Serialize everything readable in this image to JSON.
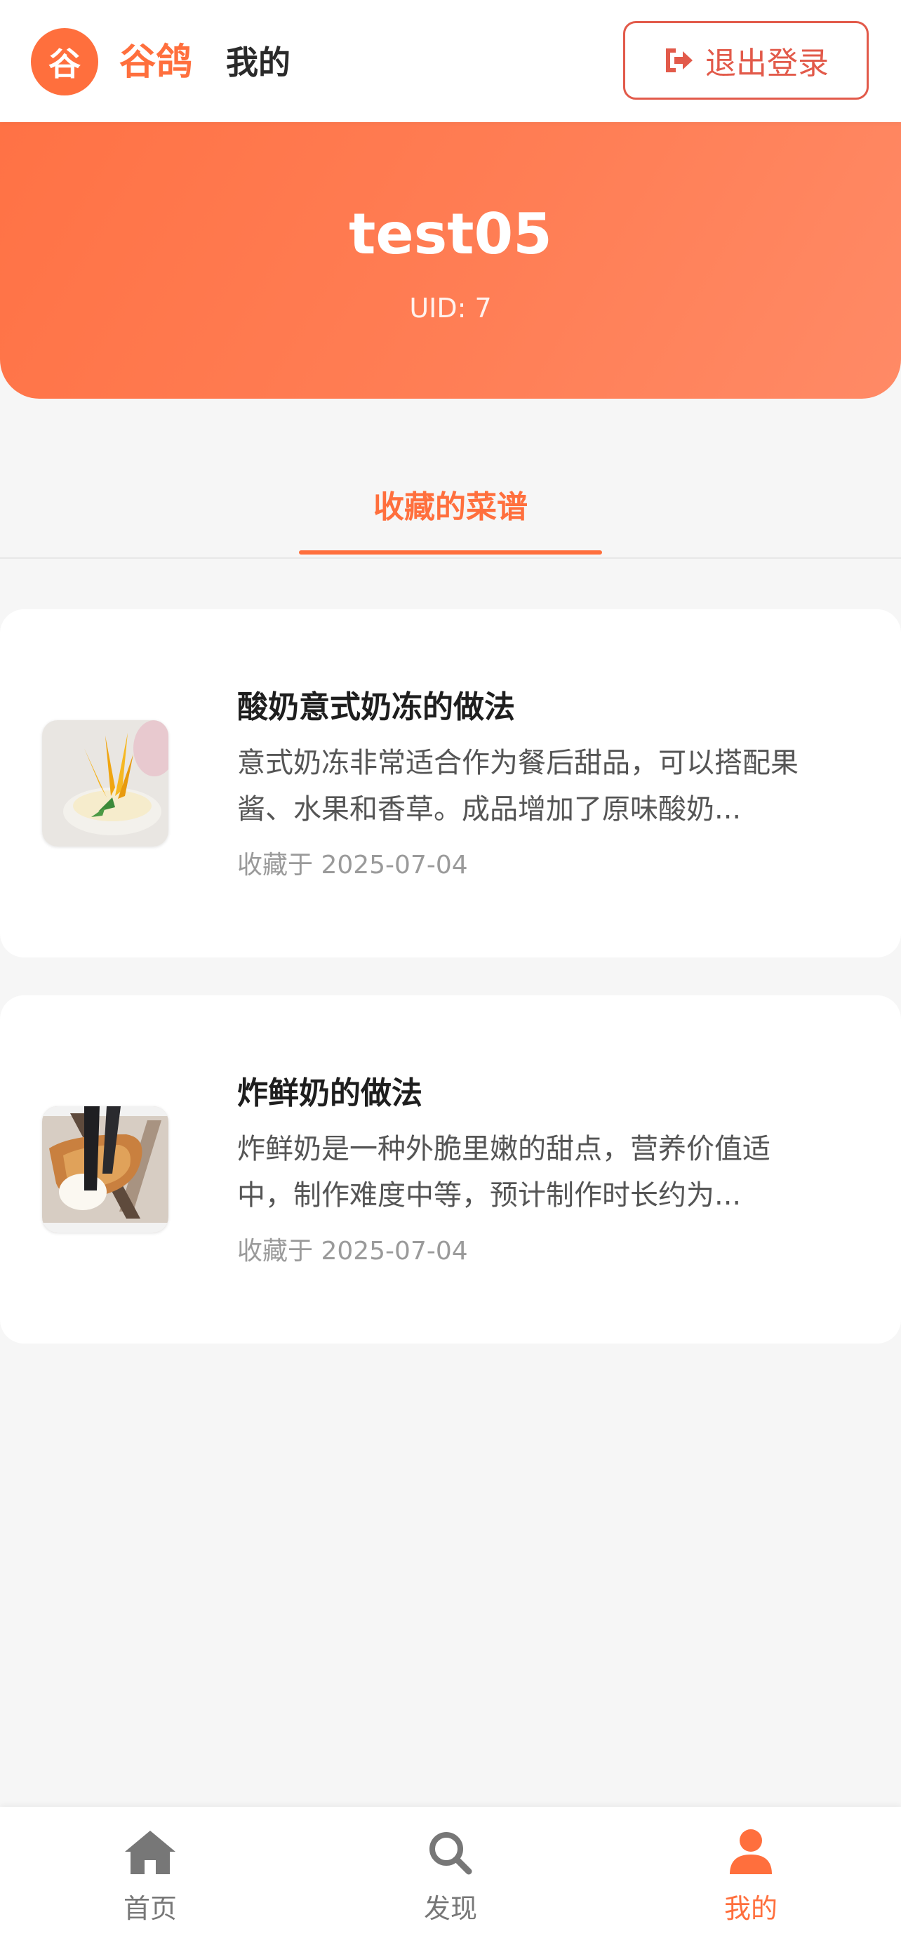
{
  "header": {
    "logo_char": "谷",
    "brand": "谷鸽",
    "page_title": "我的",
    "logout_label": "退出登录"
  },
  "profile": {
    "username": "test05",
    "uid": "UID: 7"
  },
  "tabs": [
    {
      "label": "收藏的菜谱",
      "active": true
    }
  ],
  "favorites": [
    {
      "title": "酸奶意式奶冻的做法",
      "desc_line1": "意式奶冻非常适合作为餐后甜品，可以搭配果",
      "desc_line2": "酱、水果和香草。成品增加了原味酸奶...",
      "date": "收藏于 2025-07-04"
    },
    {
      "title": "炸鲜奶的做法",
      "desc_line1": "炸鲜奶是一种外脆里嫩的甜点，营养价值适",
      "desc_line2": "中，制作难度中等，预计制作时长约为...",
      "date": "收藏于 2025-07-04"
    }
  ],
  "bottom_nav": [
    {
      "label": "首页",
      "icon": "home-icon",
      "active": false
    },
    {
      "label": "发现",
      "icon": "search-icon",
      "active": false
    },
    {
      "label": "我的",
      "icon": "user-icon",
      "active": true
    }
  ],
  "colors": {
    "accent": "#ff6f3d",
    "logout": "#e25a4a",
    "background": "#f6f6f6"
  }
}
